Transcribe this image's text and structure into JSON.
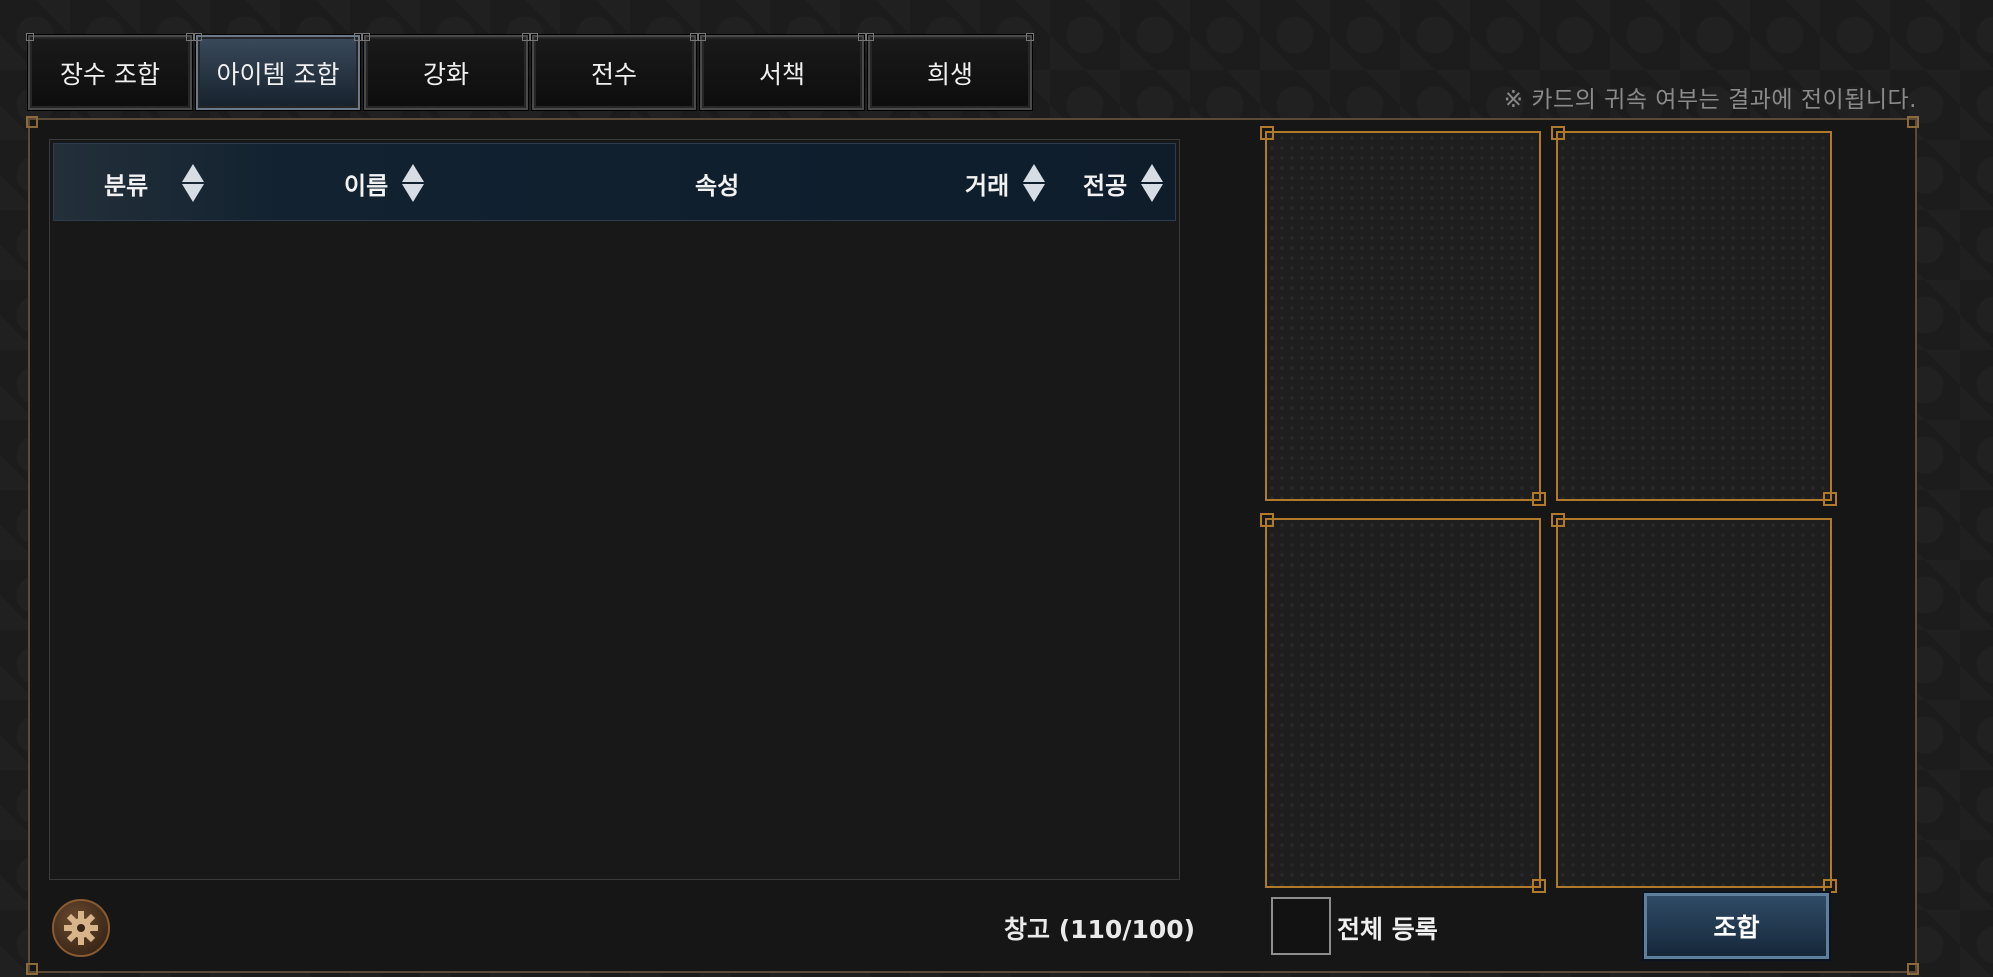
{
  "tabs": [
    {
      "label": "장수 조합",
      "active": false
    },
    {
      "label": "아이템 조합",
      "active": true
    },
    {
      "label": "강화",
      "active": false
    },
    {
      "label": "전수",
      "active": false
    },
    {
      "label": "서책",
      "active": false
    },
    {
      "label": "희생",
      "active": false
    }
  ],
  "notice": "※ 카드의 귀속 여부는 결과에 전이됩니다.",
  "list": {
    "columns": {
      "category": "분류",
      "name": "이름",
      "attribute": "속성",
      "trade": "거래",
      "merit": "전공"
    },
    "rows": []
  },
  "storage_label": "창고 (110/100)",
  "register_all_label": "전체 등록",
  "register_all_checked": false,
  "combine_label": "조합",
  "colors": {
    "slot_border": "#b07a2a",
    "active_tab": "#3a4a5c",
    "combine_button": "#2f4b66"
  }
}
